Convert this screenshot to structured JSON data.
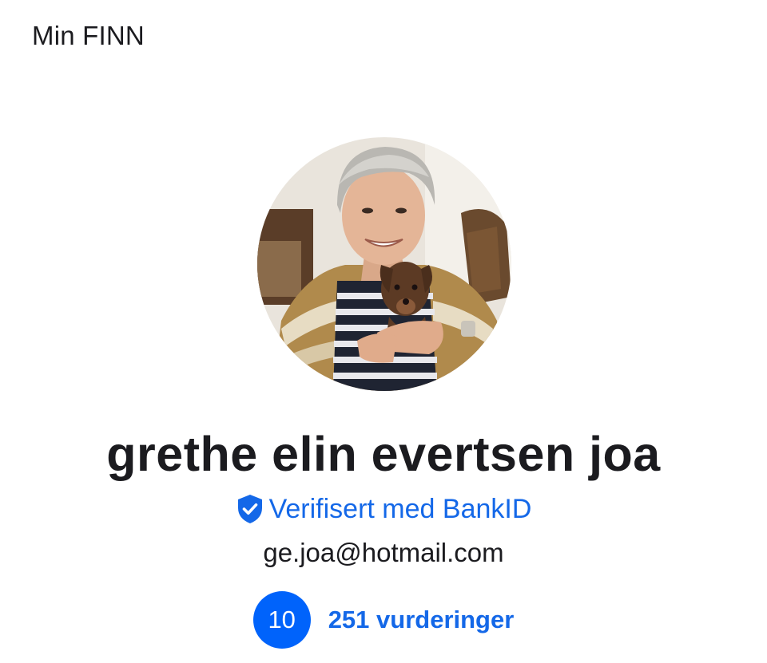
{
  "header": {
    "title": "Min FINN"
  },
  "profile": {
    "avatar_icon": "profile-photo",
    "name": "grethe elin evertsen joa",
    "verified_icon": "shield-check-icon",
    "verified_label": "Verifisert med BankID",
    "email": "ge.joa@hotmail.com",
    "score": "10",
    "reviews_label": "251 vurderinger"
  },
  "colors": {
    "accent": "#1468e8",
    "badge": "#0063fb",
    "text": "#1b1b1f",
    "background": "#ffffff"
  }
}
